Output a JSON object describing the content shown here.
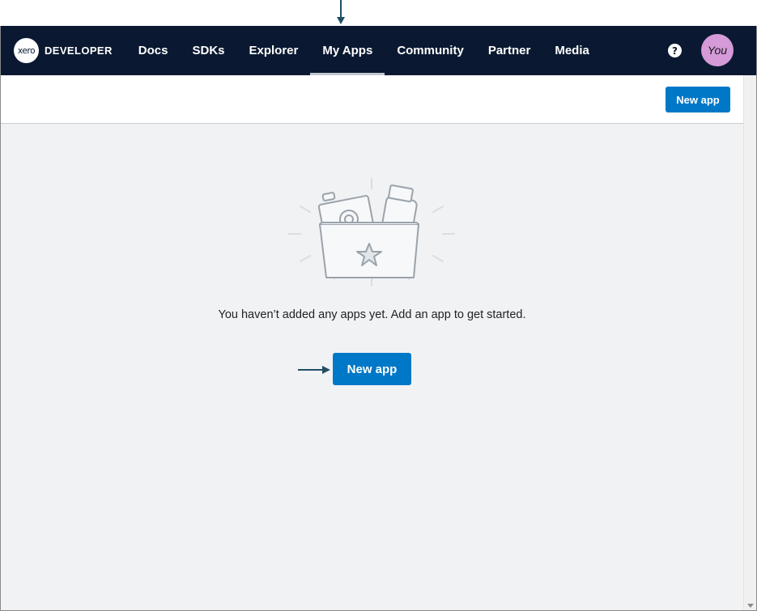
{
  "brand": {
    "logo_text": "xero",
    "title": "DEVELOPER"
  },
  "nav": {
    "items": [
      {
        "label": "Docs"
      },
      {
        "label": "SDKs"
      },
      {
        "label": "Explorer"
      },
      {
        "label": "My Apps",
        "active": true
      },
      {
        "label": "Community"
      },
      {
        "label": "Partner"
      },
      {
        "label": "Media"
      }
    ],
    "help_icon": "question-circle-icon",
    "help_glyph": "?",
    "avatar_label": "You"
  },
  "toolbar": {
    "new_app_label": "New app"
  },
  "empty_state": {
    "illustration": "folder-with-camera-and-jar-icon",
    "message": "You haven’t added any apps yet. Add an app to get started.",
    "new_app_label": "New app"
  },
  "colors": {
    "nav_bg": "#0a1931",
    "primary_button": "#0078c8",
    "avatar_bg": "#d59ad8",
    "page_bg": "#f1f2f4",
    "annotation_arrow": "#1f4e66"
  }
}
